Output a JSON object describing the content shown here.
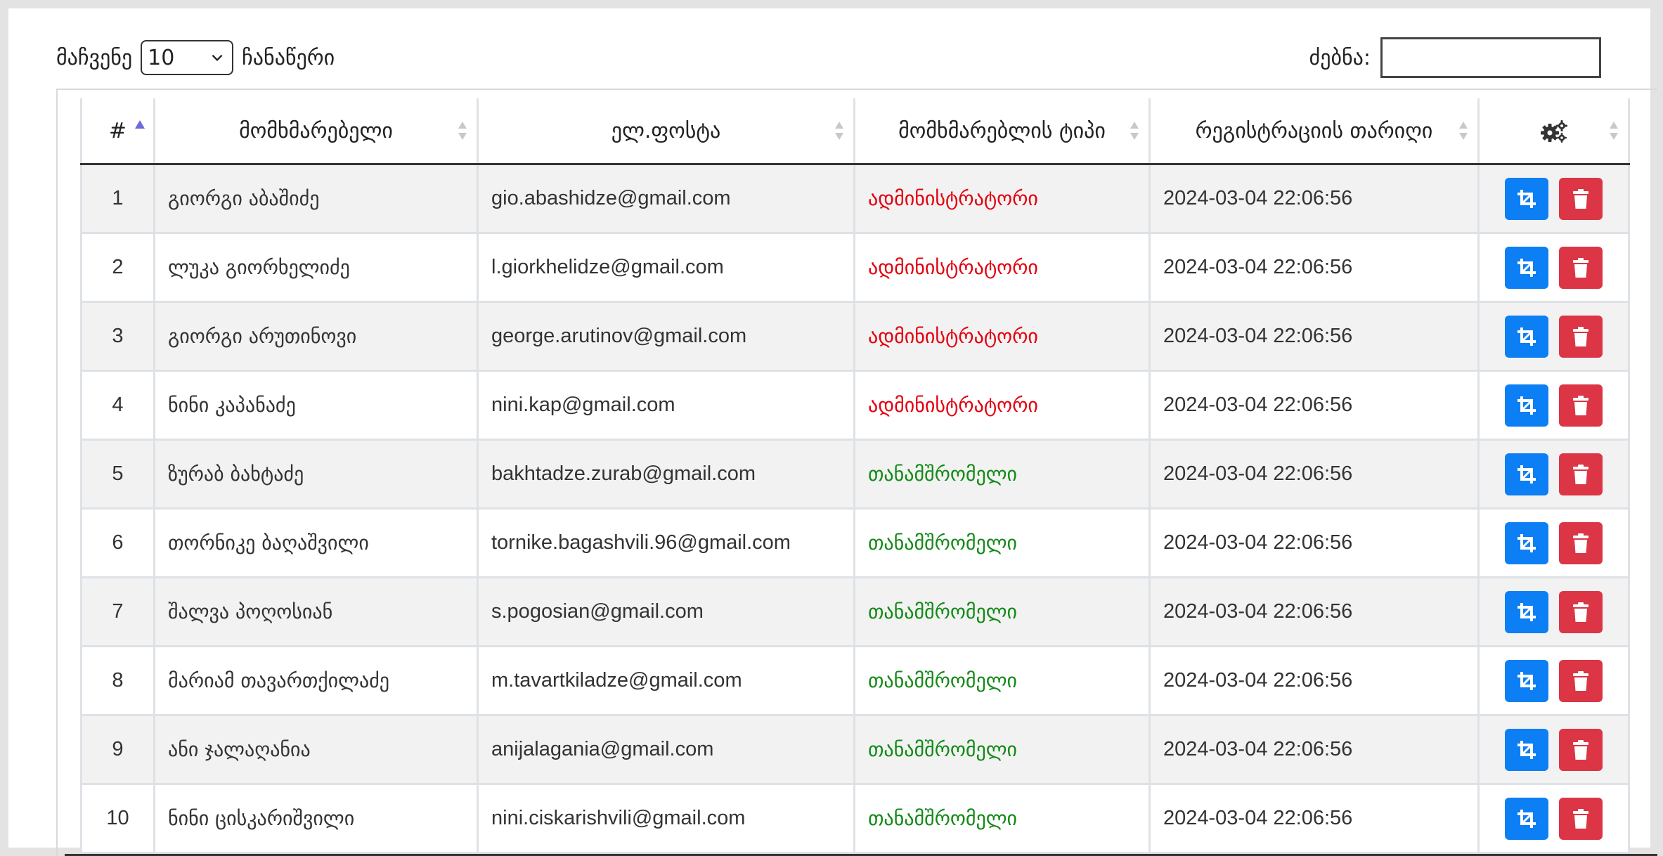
{
  "controls": {
    "show_label": "მაჩვენე",
    "page_length": "10",
    "entries_label": "ჩანაწერი",
    "search_label": "ძებნა:",
    "search_value": ""
  },
  "table": {
    "headers": [
      "#",
      "მომხმარებელი",
      "ელ.ფოსტა",
      "მომხმარებლის ტიპი",
      "რეგისტრაციის თარიღი"
    ],
    "settings_icon": "gears-icon",
    "sorted_column": "#",
    "sort_direction": "ascending",
    "rows": [
      {
        "num": "1",
        "name": "გიორგი აბაშიძე",
        "email": "gio.abashidze@gmail.com",
        "type": "ადმინისტრატორი",
        "type_kind": "admin",
        "date": "2024-03-04 22:06:56"
      },
      {
        "num": "2",
        "name": "ლუკა გიორხელიძე",
        "email": "l.giorkhelidze@gmail.com",
        "type": "ადმინისტრატორი",
        "type_kind": "admin",
        "date": "2024-03-04 22:06:56"
      },
      {
        "num": "3",
        "name": "გიორგი არუთინოვი",
        "email": "george.arutinov@gmail.com",
        "type": "ადმინისტრატორი",
        "type_kind": "admin",
        "date": "2024-03-04 22:06:56"
      },
      {
        "num": "4",
        "name": "ნინი კაპანაძე",
        "email": "nini.kap@gmail.com",
        "type": "ადმინისტრატორი",
        "type_kind": "admin",
        "date": "2024-03-04 22:06:56"
      },
      {
        "num": "5",
        "name": "ზურაბ ბახტაძე",
        "email": "bakhtadze.zurab@gmail.com",
        "type": "თანამშრომელი",
        "type_kind": "employee",
        "date": "2024-03-04 22:06:56"
      },
      {
        "num": "6",
        "name": "თორნიკე ბაღაშვილი",
        "email": "tornike.bagashvili.96@gmail.com",
        "type": "თანამშრომელი",
        "type_kind": "employee",
        "date": "2024-03-04 22:06:56"
      },
      {
        "num": "7",
        "name": "შალვა პოღოსიან",
        "email": "s.pogosian@gmail.com",
        "type": "თანამშრომელი",
        "type_kind": "employee",
        "date": "2024-03-04 22:06:56"
      },
      {
        "num": "8",
        "name": "მარიამ თავართქილაძე",
        "email": "m.tavartkiladze@gmail.com",
        "type": "თანამშრომელი",
        "type_kind": "employee",
        "date": "2024-03-04 22:06:56"
      },
      {
        "num": "9",
        "name": "ანი ჯალაღანია",
        "email": "anijalagania@gmail.com",
        "type": "თანამშრომელი",
        "type_kind": "employee",
        "date": "2024-03-04 22:06:56"
      },
      {
        "num": "10",
        "name": "ნინი ცისკარიშვილი",
        "email": "nini.ciskarishvili@gmail.com",
        "type": "თანამშრომელი",
        "type_kind": "employee",
        "date": "2024-03-04 22:06:56"
      }
    ],
    "row_actions": {
      "edit_icon": "crop-edit-icon",
      "delete_icon": "trash-icon"
    }
  },
  "colors": {
    "admin": "#e3000f",
    "employee": "#138a16",
    "edit_button": "#0d7ff4",
    "delete_button": "#dc3545",
    "sort_active": "#6b6bdc"
  }
}
